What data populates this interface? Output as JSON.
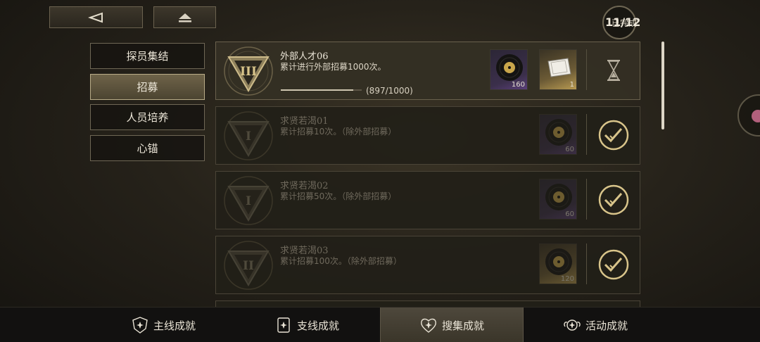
{
  "nav": {
    "back_icon": "back-arrow-icon",
    "home_icon": "eject-icon"
  },
  "progress": {
    "label": "已完成",
    "count": "11/12"
  },
  "categories": [
    {
      "label": "探员集结",
      "active": false
    },
    {
      "label": "招募",
      "active": true
    },
    {
      "label": "人员培养",
      "active": false
    },
    {
      "label": "心锚",
      "active": false
    }
  ],
  "achievements": [
    {
      "title": "外部人才06",
      "desc": "累计进行外部招募1000次。",
      "emblem": "rank-III-emblem-icon",
      "progress_text": "(897/1000)",
      "progress_fraction": 0.897,
      "rewards": [
        {
          "icon": "record-disc-icon",
          "qty": "160",
          "rarity": "purple"
        },
        {
          "icon": "ticket-card-icon",
          "qty": "1",
          "rarity": "gold"
        }
      ],
      "status": "in-progress",
      "status_icon": "hourglass-icon"
    },
    {
      "title": "求贤若渴01",
      "desc": "累计招募10次。（除外部招募）",
      "emblem": "rank-I-emblem-icon",
      "rewards": [
        {
          "icon": "record-disc-icon",
          "qty": "60",
          "rarity": "purple"
        }
      ],
      "status": "completed",
      "status_icon": "check-circle-icon"
    },
    {
      "title": "求贤若渴02",
      "desc": "累计招募50次。（除外部招募）",
      "emblem": "rank-I-emblem-icon",
      "rewards": [
        {
          "icon": "record-disc-icon",
          "qty": "60",
          "rarity": "purple"
        }
      ],
      "status": "completed",
      "status_icon": "check-circle-icon"
    },
    {
      "title": "求贤若渴03",
      "desc": "累计招募100次。（除外部招募）",
      "emblem": "rank-II-emblem-icon",
      "rewards": [
        {
          "icon": "record-disc-icon",
          "qty": "120",
          "rarity": "gold"
        }
      ],
      "status": "completed",
      "status_icon": "check-circle-icon"
    }
  ],
  "tabs": [
    {
      "label": "主线成就",
      "icon": "shield-sparkle-icon",
      "active": false
    },
    {
      "label": "支线成就",
      "icon": "card-sparkle-icon",
      "active": false
    },
    {
      "label": "搜集成就",
      "icon": "heart-sparkle-icon",
      "active": true
    },
    {
      "label": "活动成就",
      "icon": "wing-sparkle-icon",
      "active": false
    }
  ],
  "colors": {
    "accent_gold": "#d8c48a",
    "rarity_purple": "#5a3f79",
    "rarity_gold": "#b89a52"
  }
}
